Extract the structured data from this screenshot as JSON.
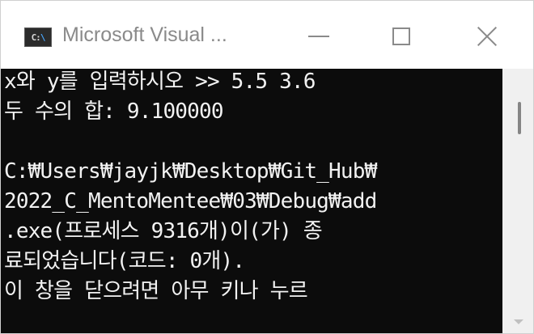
{
  "window": {
    "title": "Microsoft Visual ...",
    "icon": "console-app-icon",
    "icon_glyph_left": "C:",
    "icon_glyph_right": "\\"
  },
  "controls": {
    "minimize": "minimize-icon",
    "maximize": "maximize-icon",
    "close": "close-icon"
  },
  "console": {
    "lines": [
      "x와 y를 입력하시오 >> 5.5 3.6",
      "두 수의 합: 9.100000",
      "",
      "C:₩Users₩jayjk₩Desktop₩Git_Hub₩",
      "2022_C_MentoMentee₩03₩Debug₩add",
      ".exe(프로세스 9316개)이(가) 종",
      "료되었습니다(코드: 0개).",
      "이 창을 닫으려면 아무 키나 누르"
    ]
  },
  "colors": {
    "console_bg": "#0c0c0c",
    "console_text": "#f2f2f2",
    "titlebar_bg": "#ffffff",
    "scrollbar_bg": "#f0f0f0"
  }
}
